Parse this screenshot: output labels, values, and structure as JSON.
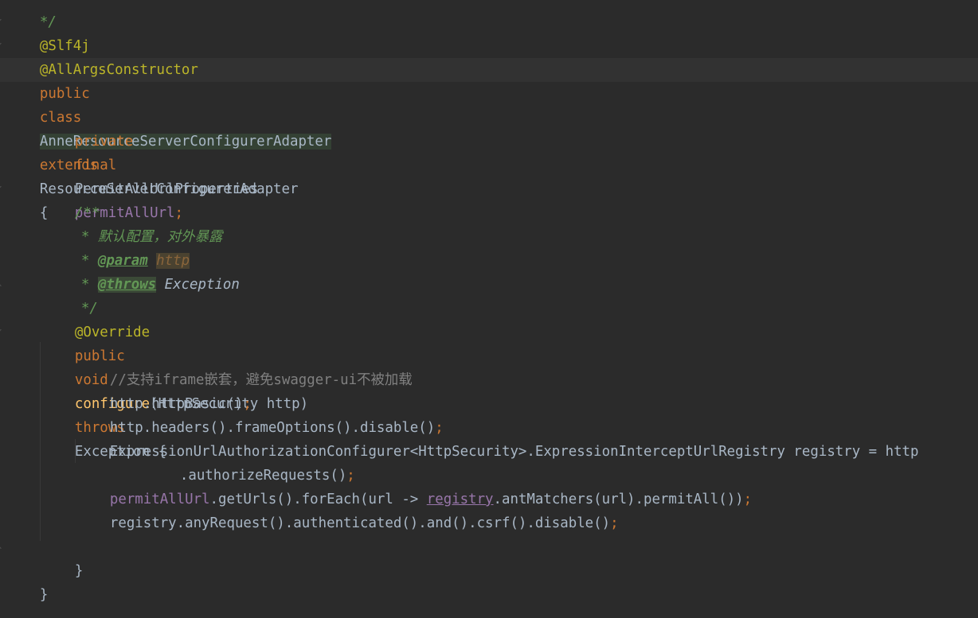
{
  "code": {
    "top_partial": "*/",
    "ann_slf4j": "@Slf4j",
    "ann_allargs": "@AllArgsConstructor",
    "decl": {
      "kw_public": "public",
      "kw_class": "class",
      "class_name": "AnneResourceServerConfigurerAdapter",
      "kw_extends": "extends",
      "parent": "ResourceServerConfigurerAdapter",
      "brace": "{"
    },
    "field_line": {
      "kw_private": "private",
      "kw_final": "final",
      "type": "PermitAllUrlProperties",
      "name": "permitAllUrl",
      "semi": ";"
    },
    "javadoc": {
      "open": "/**",
      "desc": "* 默认配置，对外暴露",
      "param_star": "* ",
      "param_tag": "@param",
      "param_name": "http",
      "throws_star": "* ",
      "throws_tag": "@throws",
      "throws_type": "Exception",
      "close": "*/"
    },
    "ann_override": "@Override",
    "method": {
      "kw_public": "public",
      "kw_void": "void",
      "name": "configure",
      "params": "(HttpSecurity http)",
      "kw_throws": "throws",
      "exc": "Exception {"
    },
    "body": {
      "comment": "//支持iframe嵌套，避免swagger-ui不被加载",
      "l1": "http.httpBasic()",
      "l2": "http.headers().frameOptions().disable()",
      "l3": "ExpressionUrlAuthorizationConfigurer<HttpSecurity>.ExpressionInterceptUrlRegistry registry = http",
      "l4": ".authorizeRequests()",
      "l5_field": "permitAllUrl",
      "l5_mid": ".getUrls().forEach(url -> ",
      "l5_reg": "registry",
      "l5_end": ".antMatchers(url).permitAll())",
      "l6": "registry.anyRequest().authenticated().and().csrf().disable()",
      "semi": ";"
    },
    "close_method": "}",
    "close_class": "}"
  },
  "colors": {
    "background": "#2b2b2b",
    "keyword": "#cc7832",
    "annotation": "#bbb529",
    "field": "#9876aa",
    "function": "#ffc66d",
    "doc_comment": "#629755",
    "line_comment": "#808080",
    "text": "#a9b7c6"
  }
}
